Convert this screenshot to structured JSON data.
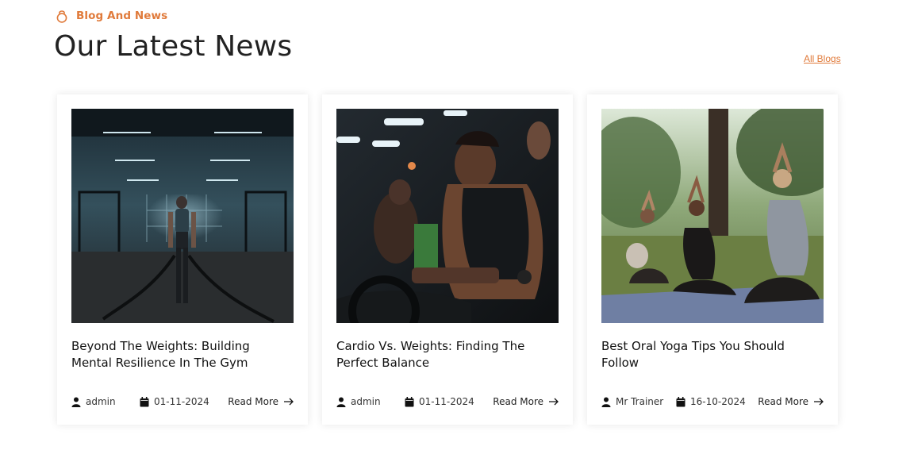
{
  "header": {
    "eyebrow": "Blog And News",
    "title": "Our Latest News",
    "all_blogs_label": "All Blogs"
  },
  "colors": {
    "accent": "#e07a3a",
    "text": "#222222"
  },
  "posts": [
    {
      "image": "gym-battle-ropes-photo",
      "title": "Beyond The Weights: Building Mental Resilience In The Gym",
      "author": "admin",
      "date": "01-11-2024",
      "read_more": "Read More"
    },
    {
      "image": "cardio-bike-photo",
      "title": "Cardio Vs. Weights: Finding The Perfect Balance",
      "author": "admin",
      "date": "01-11-2024",
      "read_more": "Read More"
    },
    {
      "image": "outdoor-yoga-photo",
      "title": "Best Oral Yoga Tips You Should Follow",
      "author": "Mr Trainer",
      "date": "16-10-2024",
      "read_more": "Read More"
    }
  ]
}
